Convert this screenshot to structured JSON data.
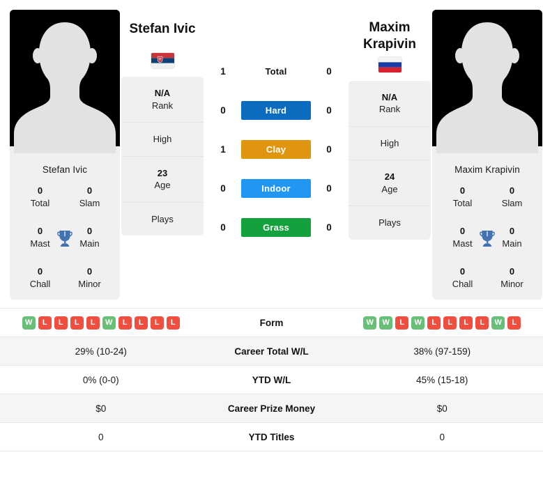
{
  "players": {
    "left": {
      "name": "Stefan Ivic",
      "flag_name": "serbia-flag",
      "photo_name": "player-photo-placeholder",
      "achievements": {
        "title": "Stefan Ivic",
        "cells": [
          {
            "value": "0",
            "label": "Total"
          },
          {
            "value": "0",
            "label": "Slam"
          },
          {
            "value": "0",
            "label": "Mast"
          },
          {
            "value": "0",
            "label": "Main"
          },
          {
            "value": "0",
            "label": "Chall"
          },
          {
            "value": "0",
            "label": "Minor"
          }
        ],
        "trophy_icon": "trophy-icon"
      },
      "rank": {
        "value": "N/A",
        "label": "Rank"
      },
      "high": "High",
      "age": {
        "value": "23",
        "label": "Age"
      },
      "plays": "Plays"
    },
    "right": {
      "name": "Maxim Krapivin",
      "flag_name": "russia-flag",
      "photo_name": "player-photo-placeholder",
      "achievements": {
        "title": "Maxim Krapivin",
        "cells": [
          {
            "value": "0",
            "label": "Total"
          },
          {
            "value": "0",
            "label": "Slam"
          },
          {
            "value": "0",
            "label": "Mast"
          },
          {
            "value": "0",
            "label": "Main"
          },
          {
            "value": "0",
            "label": "Chall"
          },
          {
            "value": "0",
            "label": "Minor"
          }
        ],
        "trophy_icon": "trophy-icon"
      },
      "rank": {
        "value": "N/A",
        "label": "Rank"
      },
      "high": "High",
      "age": {
        "value": "24",
        "label": "Age"
      },
      "plays": "Plays"
    }
  },
  "surfaces": [
    {
      "label": "Total",
      "left": "1",
      "right": "0",
      "color": "",
      "plain": true
    },
    {
      "label": "Hard",
      "left": "0",
      "right": "0",
      "color": "#0b6cbf",
      "plain": false
    },
    {
      "label": "Clay",
      "left": "1",
      "right": "0",
      "color": "#e09510",
      "plain": false
    },
    {
      "label": "Indoor",
      "left": "0",
      "right": "0",
      "color": "#2196f3",
      "plain": false
    },
    {
      "label": "Grass",
      "left": "0",
      "right": "0",
      "color": "#14a03c",
      "plain": false
    }
  ],
  "stats_table": {
    "form": {
      "label": "Form",
      "left": [
        "W",
        "L",
        "L",
        "L",
        "L",
        "W",
        "L",
        "L",
        "L",
        "L"
      ],
      "right": [
        "W",
        "W",
        "L",
        "W",
        "L",
        "L",
        "L",
        "L",
        "W",
        "L"
      ],
      "win_color": "#68bf77",
      "loss_color": "#f04e3e"
    },
    "rows": [
      {
        "label": "Career Total W/L",
        "left": "29% (10-24)",
        "right": "38% (97-159)"
      },
      {
        "label": "YTD W/L",
        "left": "0% (0-0)",
        "right": "45% (15-18)"
      },
      {
        "label": "Career Prize Money",
        "left": "$0",
        "right": "$0"
      },
      {
        "label": "YTD Titles",
        "left": "0",
        "right": "0"
      }
    ]
  }
}
